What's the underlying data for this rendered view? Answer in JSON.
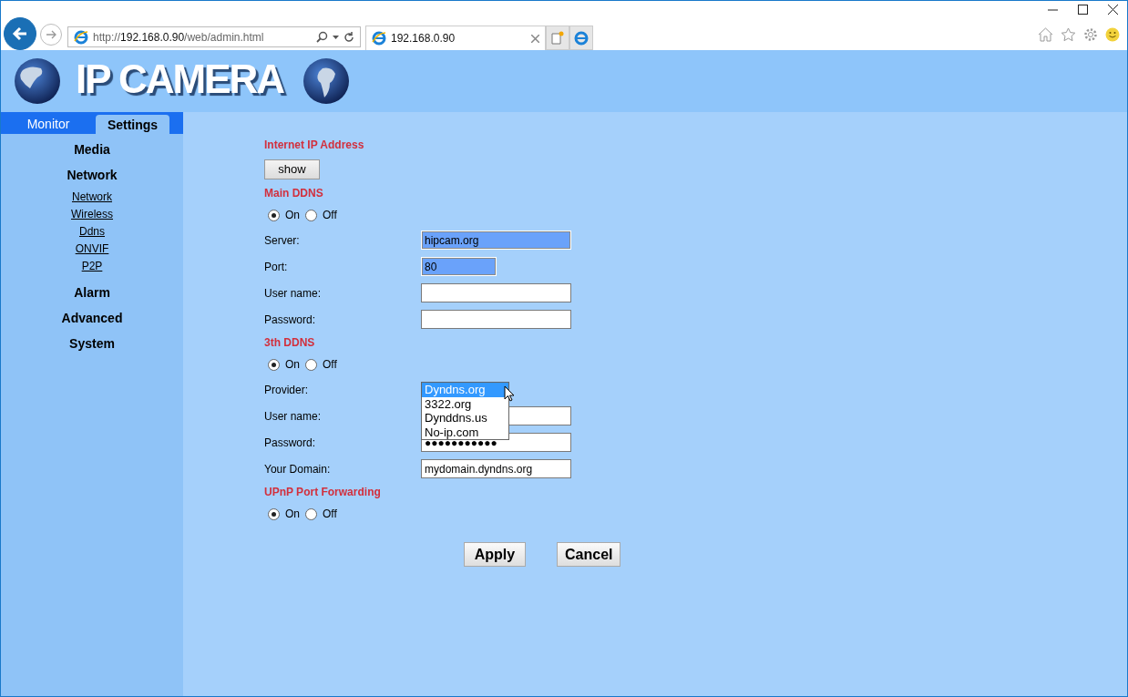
{
  "browser": {
    "address": {
      "protocol": "http://",
      "host": "192.168.0.90",
      "path": "/web/admin.html"
    },
    "tab": {
      "title": "192.168.0.90"
    }
  },
  "header": {
    "logo_text": "IP CAMERA"
  },
  "sidebar": {
    "tabs": [
      {
        "label": "Monitor",
        "selected": false
      },
      {
        "label": "Settings",
        "selected": true
      }
    ],
    "items": [
      {
        "label": "Media"
      },
      {
        "label": "Network",
        "children": [
          {
            "label": "Network"
          },
          {
            "label": "Wireless"
          },
          {
            "label": "Ddns"
          },
          {
            "label": "ONVIF"
          },
          {
            "label": "P2P"
          }
        ]
      },
      {
        "label": "Alarm"
      },
      {
        "label": "Advanced"
      },
      {
        "label": "System"
      }
    ]
  },
  "sections": [
    {
      "title": "Internet IP Address",
      "rows": [
        {
          "kind": "button",
          "label": "show"
        }
      ]
    },
    {
      "title": "Main DDNS",
      "rows": [
        {
          "kind": "radio",
          "options": [
            {
              "label": "On",
              "selected": true
            },
            {
              "label": "Off",
              "selected": false
            }
          ]
        },
        {
          "kind": "text",
          "label": "Server:",
          "value": "hipcam.org",
          "autofilled": true,
          "narrow": false
        },
        {
          "kind": "text",
          "label": "Port:",
          "value": "80",
          "autofilled": true,
          "narrow": true
        },
        {
          "kind": "text",
          "label": "User name:",
          "autofilled": false,
          "narrow": false
        },
        {
          "kind": "text",
          "label": "Password:",
          "autofilled": false,
          "narrow": false
        }
      ]
    },
    {
      "title": "3th DDNS",
      "rows": [
        {
          "kind": "radio",
          "options": [
            {
              "label": "On",
              "selected": true
            },
            {
              "label": "Off",
              "selected": false
            }
          ]
        },
        {
          "kind": "select",
          "label": "Provider:",
          "options": [
            {
              "label": "Dyndns.org",
              "selected": true
            },
            {
              "label": "3322.org",
              "selected": false
            },
            {
              "label": "Dynddns.us",
              "selected": false
            },
            {
              "label": "No-ip.com",
              "selected": false
            }
          ]
        },
        {
          "kind": "text",
          "label": "User name:",
          "autofilled": false,
          "narrow": false
        },
        {
          "kind": "text",
          "label": "Password:",
          "value": "●●●●●●●●●●●",
          "autofilled": false,
          "narrow": false
        },
        {
          "kind": "text",
          "label": "Your Domain:",
          "value": "mydomain.dyndns.org",
          "autofilled": false,
          "narrow": false
        }
      ]
    },
    {
      "title": "UPnP Port Forwarding",
      "rows": [
        {
          "kind": "radio",
          "options": [
            {
              "label": "On",
              "selected": true
            },
            {
              "label": "Off",
              "selected": false
            }
          ]
        }
      ]
    }
  ],
  "buttons": [
    {
      "label": "Apply"
    },
    {
      "label": "Cancel"
    }
  ]
}
